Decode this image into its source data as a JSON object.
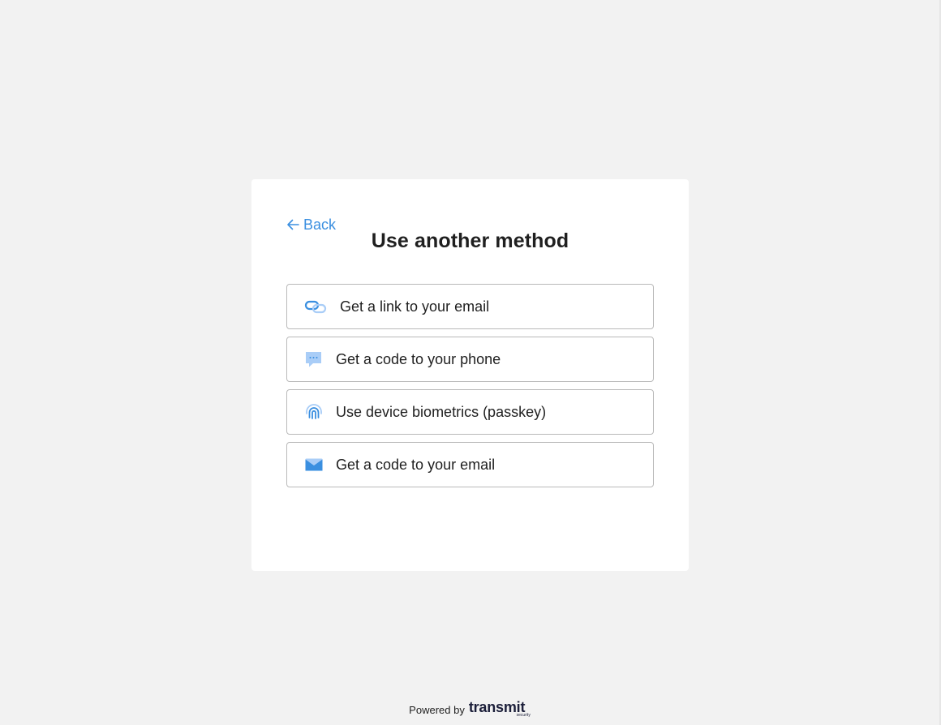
{
  "card": {
    "back_label": "Back",
    "title": "Use another method"
  },
  "methods": [
    {
      "icon": "link-icon",
      "label": "Get a link to your email"
    },
    {
      "icon": "chat-bubble-icon",
      "label": "Get a code to your phone"
    },
    {
      "icon": "fingerprint-icon",
      "label": "Use device biometrics (passkey)"
    },
    {
      "icon": "envelope-icon",
      "label": "Get a code to your email"
    }
  ],
  "footer": {
    "powered_by": "Powered by",
    "brand": "transmit",
    "brand_sub": "security"
  },
  "colors": {
    "background": "#f2f2f2",
    "card": "#ffffff",
    "accent": "#3a8fe0",
    "icon_light": "#a9cdf7",
    "border": "#b9b9b9",
    "text": "#1f1f1f",
    "brand": "#1c1f3a"
  }
}
